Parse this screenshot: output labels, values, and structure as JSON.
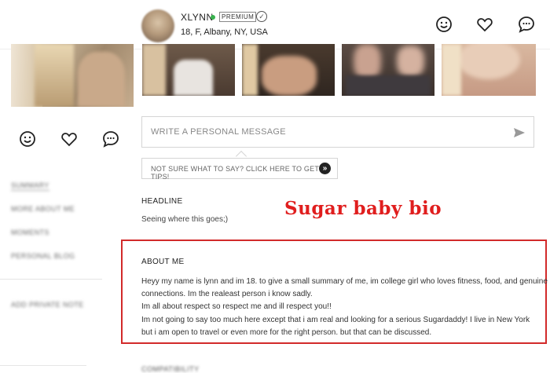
{
  "profile": {
    "username": "XLYNN",
    "badge": "PREMIUM",
    "details": "18, F, Albany, NY, USA"
  },
  "header_actions": [
    {
      "icon": "smile-icon",
      "label": ""
    },
    {
      "icon": "heart-icon",
      "label": ""
    },
    {
      "icon": "chat-icon",
      "label": ""
    }
  ],
  "sidebar": {
    "items": [
      {
        "label": "SUMMARY"
      },
      {
        "label": "MORE ABOUT ME"
      },
      {
        "label": "MOMENTS"
      },
      {
        "label": "PERSONAL BLOG"
      },
      {
        "label": "ADD PRIVATE NOTE"
      }
    ]
  },
  "message": {
    "placeholder": "WRITE A PERSONAL MESSAGE",
    "tip": "NOT SURE WHAT TO SAY? CLICK HERE TO GET TIPS!",
    "tip_icon": "»"
  },
  "headline": {
    "title": "HEADLINE",
    "text": "Seeing where this goes;)"
  },
  "annotation": "Sugar baby bio",
  "about": {
    "title": "ABOUT ME",
    "lines": [
      "Heyy my name is lynn and im 18. to give a small summary of me, im college girl who loves fitness, food, and genuine",
      "connections. Im the realeast person i know sadly.",
      "Im all about respect so respect me and ill respect you!!",
      "Im not going to say too much here except that i am real and looking for a serious Sugardaddy! I live in New York",
      "but i am open to travel or even more for the right person. but that can be discussed."
    ]
  },
  "bottom_section": "COMPATIBILITY",
  "colors": {
    "online": "#37b24d",
    "annotation": "#e01e1e",
    "highlight_border": "#d22a2a"
  }
}
